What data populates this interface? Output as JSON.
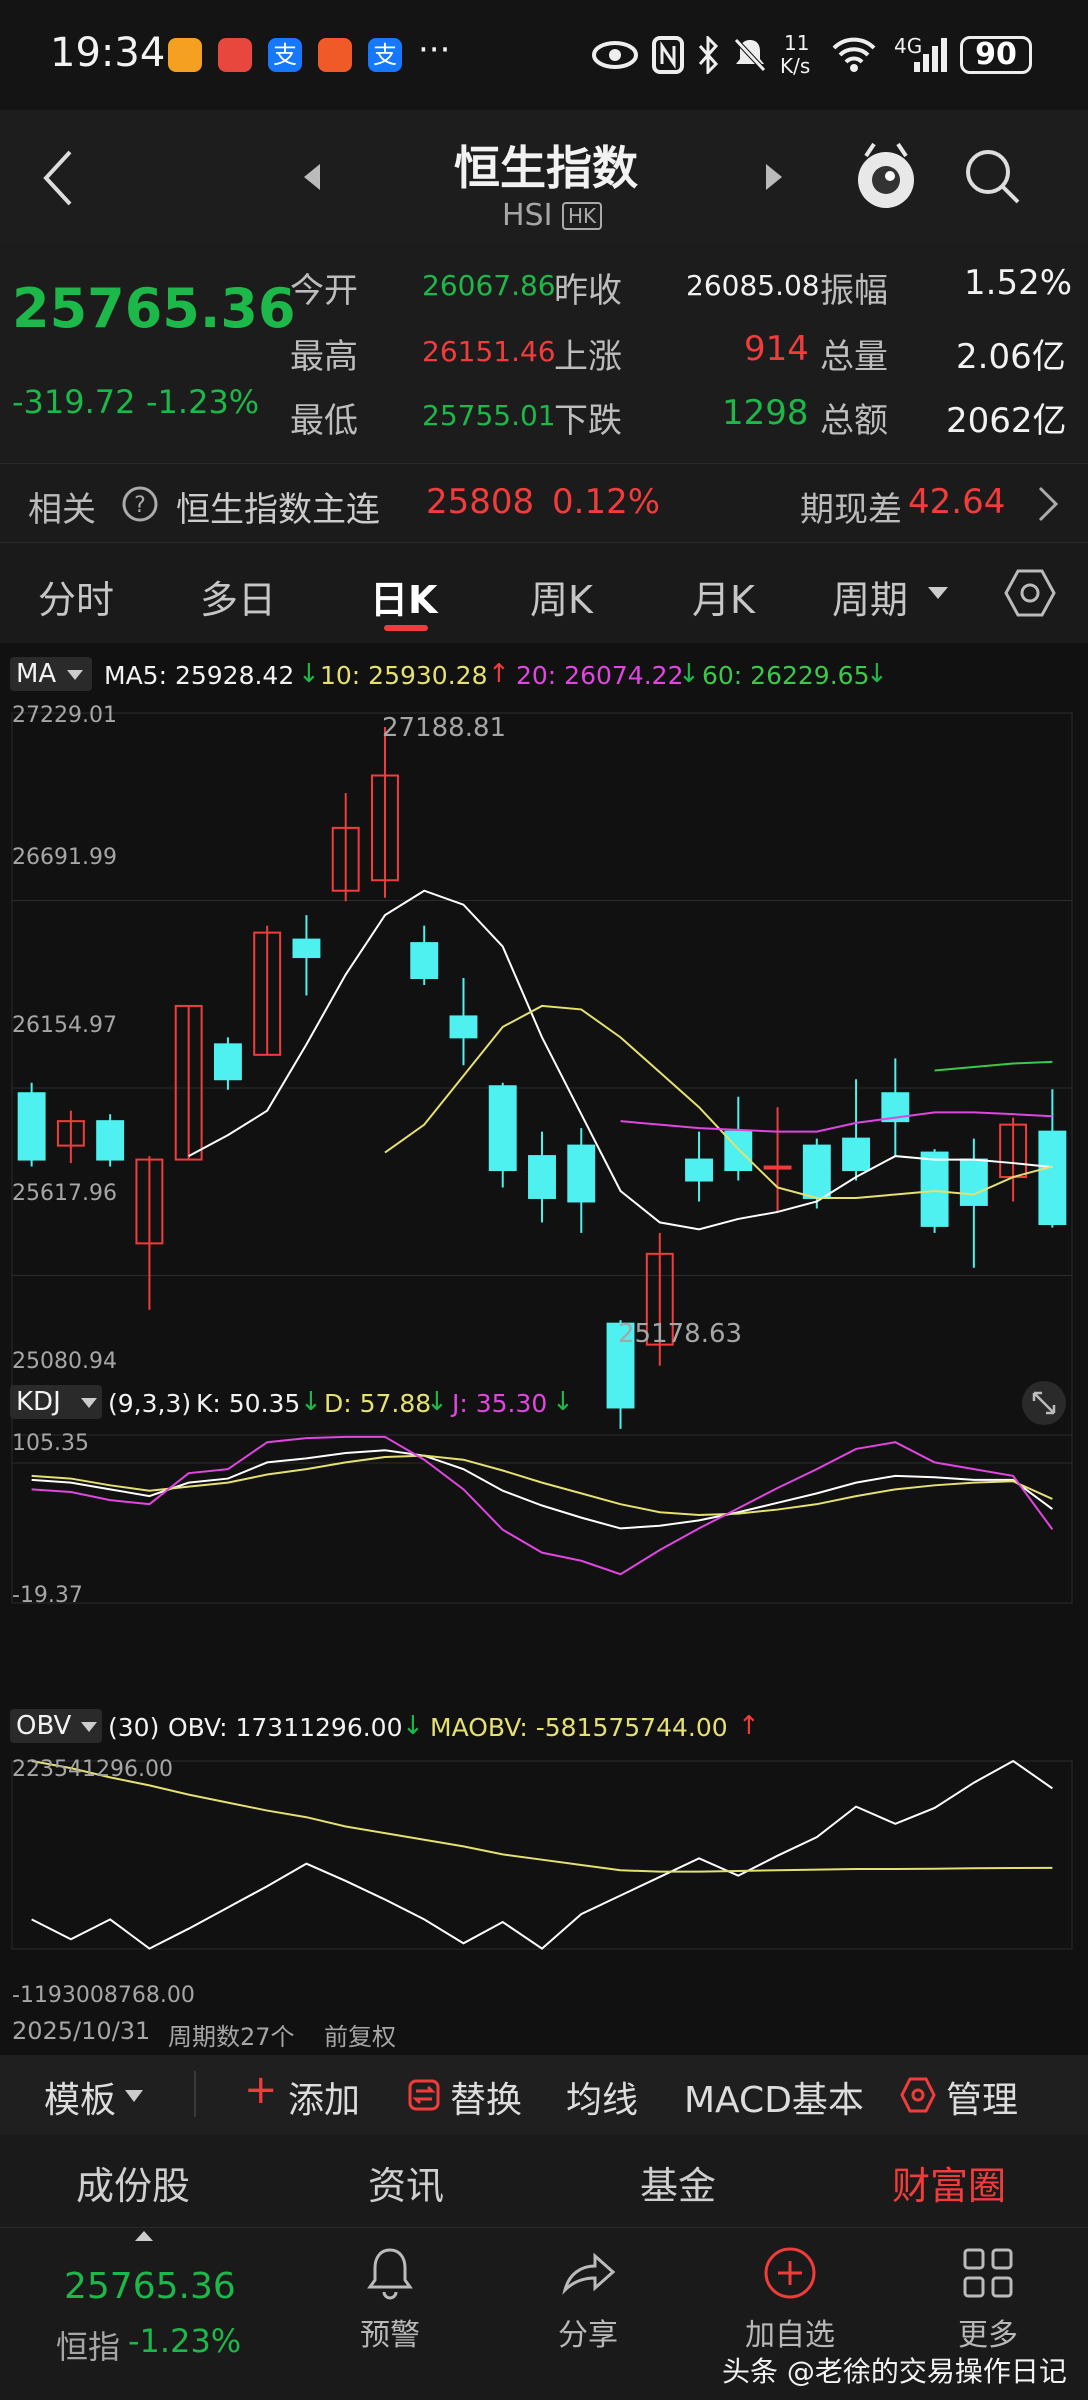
{
  "status": {
    "time": "19:34",
    "net_speed_top": "11",
    "net_speed_bottom": "K/s",
    "signal": "4G",
    "battery": "90",
    "app_icons": [
      "huawei-store",
      "huawei-app",
      "alipay",
      "wps-app",
      "alipay"
    ]
  },
  "header": {
    "title": "恒生指数",
    "code": "HSI",
    "market": "HK"
  },
  "quote": {
    "price": "25765.36",
    "change": "-319.72",
    "change_pct": "-1.23%",
    "open_label": "今开",
    "open": "26067.86",
    "prev_close_label": "昨收",
    "prev_close": "26085.08",
    "amplitude_label": "振幅",
    "amplitude": "1.52%",
    "high_label": "最高",
    "high": "26151.46",
    "up_label": "上涨",
    "up": "914",
    "volume_label": "总量",
    "volume": "2.06亿",
    "low_label": "最低",
    "low": "25755.01",
    "down_label": "下跌",
    "down": "1298",
    "turnover_label": "总额",
    "turnover": "2062亿"
  },
  "related": {
    "label": "相关",
    "name": "恒生指数主连",
    "price": "25808",
    "pct": "0.12%",
    "basis_label": "期现差",
    "basis": "42.64"
  },
  "tabs": [
    "分时",
    "多日",
    "日K",
    "周K",
    "月K",
    "周期"
  ],
  "ma_bar": {
    "name": "MA",
    "ma5": "MA5: 25928.42",
    "ma10": "10: 25930.28",
    "ma20": "20: 26074.22",
    "ma60": "60: 26229.65"
  },
  "price_axis": {
    "labels": [
      "27229.01",
      "26691.99",
      "26154.97",
      "25617.96",
      "25080.94"
    ],
    "max_label": "27188.81",
    "min_label": "25178.63"
  },
  "kdj_bar": {
    "name": "KDJ",
    "params": "(9,3,3)",
    "k": "K: 50.35",
    "d": "D: 57.88",
    "j": "J: 35.30",
    "top": "105.35",
    "bottom": "-19.37"
  },
  "obv_bar": {
    "name": "OBV",
    "params": "(30)",
    "obv": "OBV: 17311296.00",
    "maobv": "MAOBV: -581575744.00",
    "top": "223541296.00",
    "bottom": "-1193008768.00"
  },
  "chart_footer": {
    "date": "2025/10/31",
    "periods": "周期数27个",
    "adjust": "前复权"
  },
  "toolbar": {
    "template": "模板",
    "add": "添加",
    "replace": "替换",
    "ma": "均线",
    "macd": "MACD基本",
    "manage": "管理"
  },
  "subtabs": [
    "成份股",
    "资讯",
    "基金",
    "财富圈"
  ],
  "bottom": {
    "price": "25765.36",
    "name": "恒指",
    "pct": "-1.23%",
    "alert": "预警",
    "share": "分享",
    "add": "加自选",
    "more": "更多"
  },
  "watermark": "头条 @老徐的交易操作日记",
  "chart_data": [
    {
      "type": "candlestick",
      "title": "日K",
      "ylim": [
        25080.94,
        27229.01
      ],
      "candles": [
        {
          "o": 26140,
          "c": 25950,
          "h": 26170,
          "l": 25930
        },
        {
          "o": 25990,
          "c": 26060,
          "h": 26090,
          "l": 25940
        },
        {
          "o": 26060,
          "c": 25950,
          "h": 26080,
          "l": 25930
        },
        {
          "o": 25710,
          "c": 25950,
          "h": 25960,
          "l": 25520
        },
        {
          "o": 25950,
          "c": 26390,
          "h": 26390,
          "l": 25950
        },
        {
          "o": 26280,
          "c": 26180,
          "h": 26300,
          "l": 26150
        },
        {
          "o": 26250,
          "c": 26600,
          "h": 26620,
          "l": 26250
        },
        {
          "o": 26580,
          "c": 26530,
          "h": 26650,
          "l": 26420
        },
        {
          "o": 26720,
          "c": 26900,
          "h": 27000,
          "l": 26690
        },
        {
          "o": 26750,
          "c": 27050,
          "h": 27188.81,
          "l": 26700
        },
        {
          "o": 26570,
          "c": 26470,
          "h": 26620,
          "l": 26450
        },
        {
          "o": 26360,
          "c": 26300,
          "h": 26470,
          "l": 26220
        },
        {
          "o": 26160,
          "c": 25920,
          "h": 26170,
          "l": 25870
        },
        {
          "o": 25960,
          "c": 25840,
          "h": 26030,
          "l": 25770
        },
        {
          "o": 25990,
          "c": 25830,
          "h": 26040,
          "l": 25740
        },
        {
          "o": 25480,
          "c": 25240,
          "h": 25490,
          "l": 25178.63
        },
        {
          "o": 25420,
          "c": 25680,
          "h": 25740,
          "l": 25360
        },
        {
          "o": 25950,
          "c": 25890,
          "h": 26030,
          "l": 25830
        },
        {
          "o": 26030,
          "c": 25920,
          "h": 26130,
          "l": 25890
        },
        {
          "o": 25930,
          "c": 25930,
          "h": 26100,
          "l": 25800
        },
        {
          "o": 25990,
          "c": 25840,
          "h": 26010,
          "l": 25810
        },
        {
          "o": 26010,
          "c": 25920,
          "h": 26180,
          "l": 25890
        },
        {
          "o": 26140,
          "c": 26060,
          "h": 26240,
          "l": 25960
        },
        {
          "o": 25970,
          "c": 25760,
          "h": 25980,
          "l": 25740
        },
        {
          "o": 25950,
          "c": 25820,
          "h": 26010,
          "l": 25640
        },
        {
          "o": 25900,
          "c": 26050,
          "h": 26070,
          "l": 25830
        },
        {
          "o": 26030,
          "c": 25765.36,
          "h": 26151.46,
          "l": 25755.01
        }
      ],
      "series": [
        {
          "name": "MA5",
          "color": "#ffffff",
          "values": [
            null,
            null,
            null,
            null,
            25960,
            26020,
            26090,
            26280,
            26480,
            26650,
            26720,
            26680,
            26560,
            26300,
            26080,
            25860,
            25770,
            25750,
            25780,
            25800,
            25830,
            25900,
            25960,
            25950,
            25950,
            25940,
            25928.42
          ]
        },
        {
          "name": "10",
          "color": "#e5e070",
          "values": [
            null,
            null,
            null,
            null,
            null,
            null,
            null,
            null,
            null,
            25970,
            26050,
            26190,
            26330,
            26390,
            26380,
            26300,
            26200,
            26100,
            25980,
            25870,
            25840,
            25840,
            25850,
            25860,
            25850,
            25900,
            25930.28
          ]
        },
        {
          "name": "20",
          "color": "#e046e0",
          "values": [
            null,
            null,
            null,
            null,
            null,
            null,
            null,
            null,
            null,
            null,
            null,
            null,
            null,
            null,
            null,
            26060,
            26050,
            26040,
            26035,
            26030,
            26030,
            26055,
            26070,
            26085,
            26085,
            26080,
            26074.22
          ]
        },
        {
          "name": "60",
          "color": "#3cc84a",
          "values": [
            null,
            null,
            null,
            null,
            null,
            null,
            null,
            null,
            null,
            null,
            null,
            null,
            null,
            null,
            null,
            null,
            null,
            null,
            null,
            null,
            null,
            null,
            null,
            26205,
            26215,
            26225,
            26229.65
          ]
        }
      ]
    },
    {
      "type": "line",
      "title": "KDJ",
      "ylim": [
        -19.37,
        105.35
      ],
      "series": [
        {
          "name": "K",
          "color": "#ffffff",
          "values": [
            72,
            70,
            65,
            60,
            70,
            73,
            85,
            88,
            92,
            94,
            90,
            80,
            64,
            53,
            44,
            36,
            38,
            42,
            48,
            55,
            62,
            70,
            75,
            74,
            72,
            72,
            50.35
          ]
        },
        {
          "name": "D",
          "color": "#e5e070",
          "values": [
            75,
            73,
            68,
            64,
            67,
            70,
            76,
            80,
            85,
            89,
            90,
            87,
            79,
            70,
            62,
            54,
            48,
            46,
            47,
            50,
            54,
            60,
            65,
            68,
            70,
            71,
            57.88
          ]
        },
        {
          "name": "J",
          "color": "#e046e0",
          "values": [
            65,
            63,
            57,
            54,
            77,
            80,
            100,
            103,
            104,
            104,
            87,
            65,
            35,
            18,
            12,
            2,
            20,
            36,
            51,
            66,
            80,
            95,
            100,
            85,
            80,
            75,
            35.3
          ]
        }
      ]
    },
    {
      "type": "line",
      "title": "OBV",
      "ylim": [
        -1193008768,
        223541296
      ],
      "series": [
        {
          "name": "OBV",
          "color": "#ffffff",
          "values": [
            -970000000,
            -1120000000,
            -970000000,
            -1190000000,
            -1040000000,
            -880000000,
            -720000000,
            -550000000,
            -680000000,
            -820000000,
            -970000000,
            -1150000000,
            -990000000,
            -1190000000,
            -930000000,
            -790000000,
            -650000000,
            -510000000,
            -640000000,
            -490000000,
            -350000000,
            -120000000,
            -250000000,
            -130000000,
            60000000,
            223541296,
            17311296
          ]
        },
        {
          "name": "MAOBV",
          "color": "#e5e070",
          "values": [
            223541296,
            170000000,
            100000000,
            40000000,
            -30000000,
            -90000000,
            -150000000,
            -200000000,
            -270000000,
            -320000000,
            -370000000,
            -420000000,
            -480000000,
            -520000000,
            -560000000,
            -600000000,
            -610000000,
            -610000000,
            -605000000,
            -600000000,
            -595000000,
            -590000000,
            -590000000,
            -588000000,
            -585000000,
            -583000000,
            -581575744
          ]
        }
      ]
    }
  ]
}
